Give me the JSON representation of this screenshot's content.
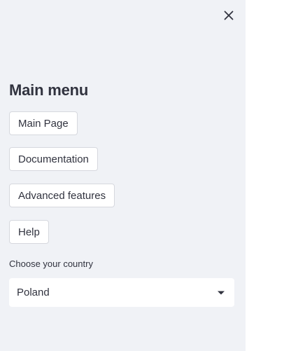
{
  "sidebar": {
    "title": "Main menu",
    "buttons": [
      {
        "label": "Main Page"
      },
      {
        "label": "Documentation"
      },
      {
        "label": "Advanced features"
      },
      {
        "label": "Help"
      }
    ],
    "country_select": {
      "label": "Choose your country",
      "value": "Poland"
    },
    "close_icon": "close-icon",
    "dropdown_icon": "caret-down-icon"
  },
  "colors": {
    "sidebar_bg": "#f0f2f6",
    "text": "#31333f",
    "button_border": "#d6d8de",
    "main_bg": "#ffffff"
  }
}
